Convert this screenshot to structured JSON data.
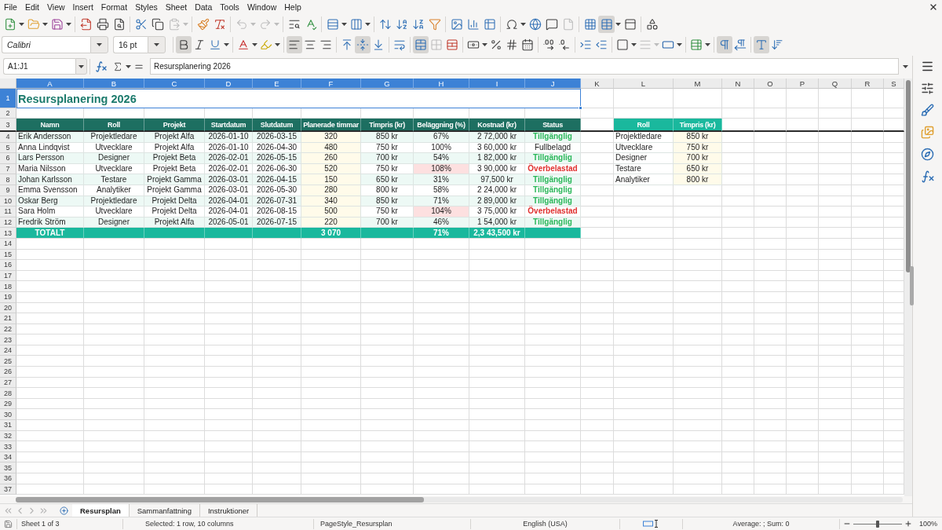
{
  "menu_bar": {
    "items": [
      "File",
      "Edit",
      "View",
      "Insert",
      "Format",
      "Styles",
      "Sheet",
      "Data",
      "Tools",
      "Window",
      "Help"
    ]
  },
  "standard_toolbar": {
    "paste": {
      "disabled": true
    },
    "undo": {
      "disabled": true
    },
    "redo": {
      "disabled": true
    },
    "headers_footers": {
      "disabled": true
    },
    "freeze_rows_columns": {
      "pressed": true
    }
  },
  "formatting_toolbar": {
    "font_name": "Calibri",
    "font_size": "16 pt",
    "bold": true,
    "italic": false,
    "underline": false,
    "align_left": true,
    "align_center": false,
    "align_right": false,
    "align_top": false,
    "align_middle": true,
    "align_bottom": false,
    "wrap_text": false,
    "merge_and_center": true,
    "merge_cells": {
      "disabled": true
    },
    "border_style": {
      "disabled": true
    },
    "left_to_right": true,
    "right_to_left": false,
    "horizontal_text": true,
    "vertical_text": false
  },
  "formula_bar": {
    "name_box": "A1:J1",
    "formula": "Resursplanering 2026"
  },
  "sheet": {
    "columns": [
      {
        "label": "A",
        "selected": true
      },
      {
        "label": "B",
        "selected": true
      },
      {
        "label": "C",
        "selected": true
      },
      {
        "label": "D",
        "selected": true
      },
      {
        "label": "E",
        "selected": true
      },
      {
        "label": "F",
        "selected": true
      },
      {
        "label": "G",
        "selected": true
      },
      {
        "label": "H",
        "selected": true
      },
      {
        "label": "I",
        "selected": true
      },
      {
        "label": "J",
        "selected": true
      },
      {
        "label": "K",
        "selected": false
      },
      {
        "label": "L",
        "selected": false
      },
      {
        "label": "M",
        "selected": false
      },
      {
        "label": "N",
        "selected": false
      },
      {
        "label": "O",
        "selected": false
      },
      {
        "label": "P",
        "selected": false
      },
      {
        "label": "Q",
        "selected": false
      },
      {
        "label": "R",
        "selected": false
      },
      {
        "label": "S",
        "selected": false
      }
    ],
    "rows": [
      {
        "label": "1",
        "selected": true
      },
      {
        "label": "2",
        "selected": false
      },
      {
        "label": "3",
        "selected": false
      },
      {
        "label": "4",
        "selected": false
      },
      {
        "label": "5",
        "selected": false
      },
      {
        "label": "6",
        "selected": false
      },
      {
        "label": "7",
        "selected": false
      },
      {
        "label": "8",
        "selected": false
      },
      {
        "label": "9",
        "selected": false
      },
      {
        "label": "10",
        "selected": false
      },
      {
        "label": "11",
        "selected": false
      },
      {
        "label": "12",
        "selected": false
      },
      {
        "label": "13",
        "selected": false
      },
      {
        "label": "14",
        "selected": false
      },
      {
        "label": "15",
        "selected": false
      },
      {
        "label": "16",
        "selected": false
      },
      {
        "label": "17",
        "selected": false
      },
      {
        "label": "18",
        "selected": false
      },
      {
        "label": "19",
        "selected": false
      },
      {
        "label": "20",
        "selected": false
      },
      {
        "label": "21",
        "selected": false
      },
      {
        "label": "22",
        "selected": false
      },
      {
        "label": "23",
        "selected": false
      },
      {
        "label": "24",
        "selected": false
      },
      {
        "label": "25",
        "selected": false
      },
      {
        "label": "26",
        "selected": false
      },
      {
        "label": "27",
        "selected": false
      },
      {
        "label": "28",
        "selected": false
      },
      {
        "label": "29",
        "selected": false
      },
      {
        "label": "30",
        "selected": false
      },
      {
        "label": "31",
        "selected": false
      },
      {
        "label": "32",
        "selected": false
      },
      {
        "label": "33",
        "selected": false
      },
      {
        "label": "34",
        "selected": false
      },
      {
        "label": "35",
        "selected": false
      },
      {
        "label": "36",
        "selected": false
      },
      {
        "label": "37",
        "selected": false
      }
    ],
    "title": "Resursplanering 2026",
    "main_table": {
      "columns": [
        "Namn",
        "Roll",
        "Projekt",
        "Startdatum",
        "Slutdatum",
        "Planerade timmar",
        "Timpris (kr)",
        "Beläggning (%)",
        "Kostnad (kr)",
        "Status"
      ],
      "rows": [
        {
          "name": "Erik Andersson",
          "role": "Projektledare",
          "project": "Projekt Alfa",
          "start": "2026-01-10",
          "end": "2026-03-15",
          "hours": "320",
          "rate": "850 kr",
          "utilization": "67%",
          "over_capacity": false,
          "cost": "2 72,000 kr",
          "status": "Tillgänglig",
          "kind": "available"
        },
        {
          "name": "Anna Lindqvist",
          "role": "Utvecklare",
          "project": "Projekt Alfa",
          "start": "2026-01-10",
          "end": "2026-04-30",
          "hours": "480",
          "rate": "750 kr",
          "utilization": "100%",
          "over_capacity": false,
          "cost": "3 60,000 kr",
          "status": "Fullbelagd",
          "kind": "full"
        },
        {
          "name": "Lars Persson",
          "role": "Designer",
          "project": "Projekt Beta",
          "start": "2026-02-01",
          "end": "2026-05-15",
          "hours": "260",
          "rate": "700 kr",
          "utilization": "54%",
          "over_capacity": false,
          "cost": "1 82,000 kr",
          "status": "Tillgänglig",
          "kind": "available"
        },
        {
          "name": "Maria Nilsson",
          "role": "Utvecklare",
          "project": "Projekt Beta",
          "start": "2026-02-01",
          "end": "2026-06-30",
          "hours": "520",
          "rate": "750 kr",
          "utilization": "108%",
          "over_capacity": true,
          "cost": "3 90,000 kr",
          "status": "Överbelastad",
          "kind": "overloaded"
        },
        {
          "name": "Johan Karlsson",
          "role": "Testare",
          "project": "Projekt Gamma",
          "start": "2026-03-01",
          "end": "2026-04-15",
          "hours": "150",
          "rate": "650 kr",
          "utilization": "31%",
          "over_capacity": false,
          "cost": "97,500 kr",
          "status": "Tillgänglig",
          "kind": "available"
        },
        {
          "name": "Emma Svensson",
          "role": "Analytiker",
          "project": "Projekt Gamma",
          "start": "2026-03-01",
          "end": "2026-05-30",
          "hours": "280",
          "rate": "800 kr",
          "utilization": "58%",
          "over_capacity": false,
          "cost": "2 24,000 kr",
          "status": "Tillgänglig",
          "kind": "available"
        },
        {
          "name": "Oskar Berg",
          "role": "Projektledare",
          "project": "Projekt Delta",
          "start": "2026-04-01",
          "end": "2026-07-31",
          "hours": "340",
          "rate": "850 kr",
          "utilization": "71%",
          "over_capacity": false,
          "cost": "2 89,000 kr",
          "status": "Tillgänglig",
          "kind": "available"
        },
        {
          "name": "Sara Holm",
          "role": "Utvecklare",
          "project": "Projekt Delta",
          "start": "2026-04-01",
          "end": "2026-08-15",
          "hours": "500",
          "rate": "750 kr",
          "utilization": "104%",
          "over_capacity": true,
          "cost": "3 75,000 kr",
          "status": "Överbelastad",
          "kind": "overloaded"
        },
        {
          "name": "Fredrik Ström",
          "role": "Designer",
          "project": "Projekt Alfa",
          "start": "2026-05-01",
          "end": "2026-07-15",
          "hours": "220",
          "rate": "700 kr",
          "utilization": "46%",
          "over_capacity": false,
          "cost": "1 54,000 kr",
          "status": "Tillgänglig",
          "kind": "available"
        }
      ],
      "total": {
        "label": "TOTALT",
        "hours": "3 070",
        "utilization": "71%",
        "cost": "2,3 43,500 kr"
      }
    },
    "rate_table": {
      "columns": [
        "Roll",
        "Timpris (kr)"
      ],
      "rows": [
        {
          "role": "Projektledare",
          "rate": "850 kr"
        },
        {
          "role": "Utvecklare",
          "rate": "750 kr"
        },
        {
          "role": "Designer",
          "rate": "700 kr"
        },
        {
          "role": "Testare",
          "rate": "650 kr"
        },
        {
          "role": "Analytiker",
          "rate": "800 kr"
        }
      ]
    }
  },
  "sheet_tabs": [
    {
      "label": "Resursplan",
      "selected": true
    },
    {
      "label": "Sammanfattning",
      "selected": false
    },
    {
      "label": "Instruktioner",
      "selected": false
    }
  ],
  "status_bar": {
    "sheet_info": "Sheet 1 of 3",
    "selection": "Selected: 1 row, 10 columns",
    "page_style": "PageStyle_Resursplan",
    "language": "English (USA)",
    "statistics": "Average: ; Sum: 0",
    "zoom_slider": {
      "level": 0.5
    },
    "zoom": "100%"
  }
}
